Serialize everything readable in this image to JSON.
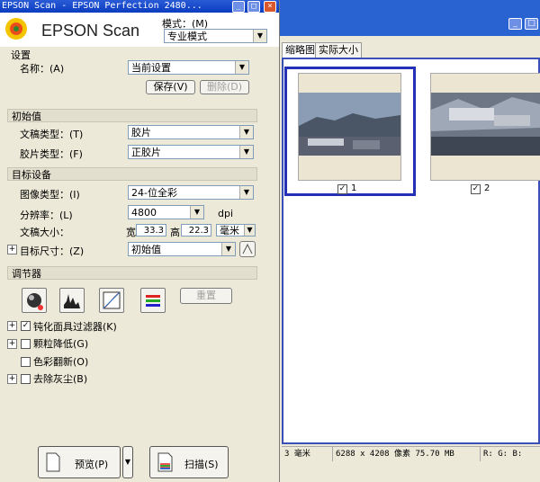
{
  "window": {
    "title": "EPSON Scan - EPSON Perfection 2480...",
    "min": "_",
    "max": "□",
    "close": "×"
  },
  "logo": {
    "text": "EPSON Scan"
  },
  "mode": {
    "label": "模式：(M)",
    "value": "专业模式"
  },
  "settings": {
    "group": "设置",
    "name_label": "名称：(A)",
    "name_value": "当前设置",
    "save_label": "保存(V)",
    "delete_label": "删除(D)"
  },
  "defaults": {
    "group": "初始值",
    "doc_type_label": "文稿类型：(T)",
    "doc_type_value": "胶片",
    "film_type_label": "胶片类型：(F)",
    "film_type_value": "正胶片"
  },
  "target": {
    "group": "目标设备",
    "image_type_label": "图像类型：(I)",
    "image_type_value": "24-位全彩",
    "resolution_label": "分辨率：(L)",
    "resolution_value": "4800",
    "resolution_unit": "dpi",
    "doc_size_label": "文稿大小：",
    "width_label": "宽",
    "width_value": "33.3",
    "height_label": "高",
    "height_value": "22.3",
    "size_unit": "毫米",
    "target_size_label": "目标尺寸：(Z)",
    "target_size_value": "初始值"
  },
  "adjust": {
    "group": "调节器",
    "reset_label": "重置",
    "options": [
      {
        "label": "钝化面具过滤器(K)",
        "checked": true,
        "expander": true
      },
      {
        "label": "颗粒降低(G)",
        "checked": false,
        "expander": true
      },
      {
        "label": "色彩翻新(O)",
        "checked": false,
        "expander": false
      },
      {
        "label": "去除灰尘(B)",
        "checked": false,
        "expander": true
      }
    ]
  },
  "actions": {
    "preview_label": "预览(P)",
    "scan_label": "扫描(S)"
  },
  "preview": {
    "tabs": [
      "缩略图",
      "实际大小"
    ],
    "frames": [
      {
        "number": "1",
        "checked": true,
        "selected": true
      },
      {
        "number": "2",
        "checked": true,
        "selected": false
      }
    ],
    "status": {
      "size": "3 毫米",
      "pixels": "6288 x 4208 像素 75.70 MB",
      "rgb": "R: G: B:"
    }
  },
  "colors": {
    "titlebar": "#0a3cc0",
    "selection": "#3b4fb9",
    "background": "#ece9d8"
  }
}
